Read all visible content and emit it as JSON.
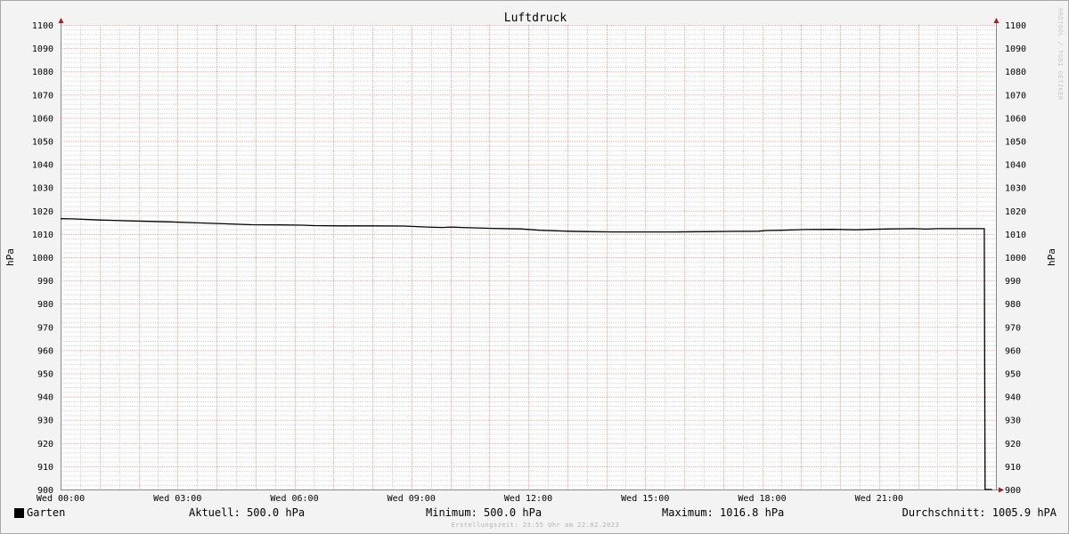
{
  "watermark": "RRDTOOL / TOBI OETIKER",
  "legend": {
    "series_name": "Garten",
    "aktuell": "Aktuell: 500.0 hPa",
    "minimum": "Minimum: 500.0 hPa",
    "maximum": "Maximum: 1016.8 hPa",
    "durchschnitt": "Durchschnitt: 1005.9 hPA"
  },
  "footer": "Erstellungszeit: 23:55 Uhr am 22.02.2023",
  "colors": {
    "line": "#000000",
    "major_grid": "#e9a5a5",
    "minor_grid": "#d6d6d6",
    "axis": "#888888",
    "arrow": "#a02020"
  },
  "chart_data": {
    "type": "line",
    "title": "Luftdruck",
    "ylabel": "hPa",
    "ylabel_right": "hPa",
    "ylim": [
      900,
      1100
    ],
    "y_ticks": [
      900,
      910,
      920,
      930,
      940,
      950,
      960,
      970,
      980,
      990,
      1000,
      1010,
      1020,
      1030,
      1040,
      1050,
      1060,
      1070,
      1080,
      1090,
      1100
    ],
    "xlim_hours": [
      0,
      24
    ],
    "x_ticks": [
      {
        "hour": 0,
        "label": "Wed 00:00"
      },
      {
        "hour": 3,
        "label": "Wed 03:00"
      },
      {
        "hour": 6,
        "label": "Wed 06:00"
      },
      {
        "hour": 9,
        "label": "Wed 09:00"
      },
      {
        "hour": 12,
        "label": "Wed 12:00"
      },
      {
        "hour": 15,
        "label": "Wed 15:00"
      },
      {
        "hour": 18,
        "label": "Wed 18:00"
      },
      {
        "hour": 21,
        "label": "Wed 21:00"
      }
    ],
    "grid": true,
    "series": [
      {
        "name": "Garten",
        "x": [
          0,
          0.3,
          1.0,
          1.9,
          2.8,
          3.5,
          4.2,
          4.9,
          5.6,
          6.2,
          6.5,
          7.2,
          8.0,
          8.8,
          9.4,
          9.8,
          10.0,
          10.3,
          11.1,
          11.8,
          12.3,
          13.0,
          13.6,
          14.2,
          15.0,
          15.8,
          16.5,
          17.2,
          17.9,
          18.1,
          18.5,
          19.1,
          19.8,
          20.4,
          20.8,
          21.3,
          21.9,
          22.2,
          22.5,
          23.0,
          23.7,
          23.72,
          23.8,
          23.9
        ],
        "y": [
          1016.6,
          1016.5,
          1016.0,
          1015.6,
          1015.2,
          1014.8,
          1014.4,
          1014.0,
          1013.9,
          1013.8,
          1013.6,
          1013.5,
          1013.5,
          1013.4,
          1013.0,
          1012.8,
          1013.0,
          1012.8,
          1012.4,
          1012.2,
          1011.6,
          1011.2,
          1011.0,
          1010.9,
          1010.9,
          1010.9,
          1011.0,
          1011.1,
          1011.2,
          1011.5,
          1011.6,
          1011.9,
          1012.0,
          1011.8,
          1012.0,
          1012.2,
          1012.3,
          1012.1,
          1012.3,
          1012.3,
          1012.3,
          500.0,
          500.0,
          500.0
        ]
      }
    ]
  }
}
